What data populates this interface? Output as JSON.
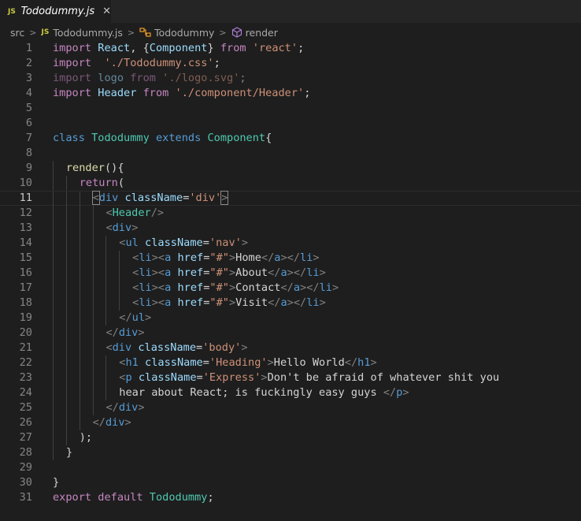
{
  "tab": {
    "badge": "JS",
    "title": "Tododummy.js",
    "close": "✕"
  },
  "breadcrumb": {
    "folder": "src",
    "file_badge": "JS",
    "file": "Tododummy.js",
    "class_name": "Tododummy",
    "method": "render",
    "separator": ">"
  },
  "editor": {
    "current_line": 11,
    "lines": [
      {
        "n": "1",
        "indent": 0,
        "t": [
          [
            "kw-imp",
            "import"
          ],
          [
            "plain",
            " "
          ],
          [
            "var",
            "React"
          ],
          [
            "plain",
            ", {"
          ],
          [
            "var",
            "Component"
          ],
          [
            "plain",
            "} "
          ],
          [
            "kw-imp",
            "from"
          ],
          [
            "plain",
            " "
          ],
          [
            "str",
            "'react'"
          ],
          [
            "plain",
            ";"
          ]
        ]
      },
      {
        "n": "2",
        "indent": 0,
        "t": [
          [
            "kw-imp",
            "import"
          ],
          [
            "plain",
            "  "
          ],
          [
            "str",
            "'./Tododummy.css'"
          ],
          [
            "plain",
            ";"
          ]
        ]
      },
      {
        "n": "3",
        "indent": 0,
        "dim": true,
        "t": [
          [
            "kw-imp",
            "import"
          ],
          [
            "plain",
            " "
          ],
          [
            "var",
            "logo"
          ],
          [
            "plain",
            " "
          ],
          [
            "kw-imp",
            "from"
          ],
          [
            "plain",
            " "
          ],
          [
            "str",
            "'./logo.svg'"
          ],
          [
            "plain",
            ";"
          ]
        ]
      },
      {
        "n": "4",
        "indent": 0,
        "t": [
          [
            "kw-imp",
            "import"
          ],
          [
            "plain",
            " "
          ],
          [
            "var",
            "Header"
          ],
          [
            "plain",
            " "
          ],
          [
            "kw-imp",
            "from"
          ],
          [
            "plain",
            " "
          ],
          [
            "str",
            "'./component/Header'"
          ],
          [
            "plain",
            ";"
          ]
        ]
      },
      {
        "n": "5",
        "indent": 0,
        "t": []
      },
      {
        "n": "6",
        "indent": 0,
        "t": []
      },
      {
        "n": "7",
        "indent": 0,
        "t": [
          [
            "kw",
            "class"
          ],
          [
            "plain",
            " "
          ],
          [
            "cls",
            "Tododummy"
          ],
          [
            "plain",
            " "
          ],
          [
            "kw",
            "extends"
          ],
          [
            "plain",
            " "
          ],
          [
            "cls",
            "Component"
          ],
          [
            "plain",
            "{"
          ]
        ]
      },
      {
        "n": "8",
        "indent": 0,
        "t": []
      },
      {
        "n": "9",
        "indent": 1,
        "t": [
          [
            "fn",
            "render"
          ],
          [
            "plain",
            "(){"
          ]
        ]
      },
      {
        "n": "10",
        "indent": 2,
        "t": [
          [
            "kw-imp",
            "return"
          ],
          [
            "plain",
            "("
          ]
        ]
      },
      {
        "n": "11",
        "indent": 3,
        "t": [
          [
            "brkt",
            "<"
          ],
          [
            "tag",
            "div"
          ],
          [
            "plain",
            " "
          ],
          [
            "attr",
            "className"
          ],
          [
            "plain",
            "="
          ],
          [
            "str",
            "'div'"
          ],
          [
            "brkt",
            ">"
          ]
        ]
      },
      {
        "n": "12",
        "indent": 4,
        "t": [
          [
            "brkt",
            "<"
          ],
          [
            "cls",
            "Header"
          ],
          [
            "brkt",
            "/>"
          ]
        ]
      },
      {
        "n": "13",
        "indent": 4,
        "t": [
          [
            "brkt",
            "<"
          ],
          [
            "tag",
            "div"
          ],
          [
            "brkt",
            ">"
          ]
        ]
      },
      {
        "n": "14",
        "indent": 5,
        "t": [
          [
            "brkt",
            "<"
          ],
          [
            "tag",
            "ul"
          ],
          [
            "plain",
            " "
          ],
          [
            "attr",
            "className"
          ],
          [
            "plain",
            "="
          ],
          [
            "str",
            "'nav'"
          ],
          [
            "brkt",
            ">"
          ]
        ]
      },
      {
        "n": "15",
        "indent": 6,
        "t": [
          [
            "brkt",
            "<"
          ],
          [
            "tag",
            "li"
          ],
          [
            "brkt",
            "><"
          ],
          [
            "tag",
            "a"
          ],
          [
            "plain",
            " "
          ],
          [
            "attr",
            "href"
          ],
          [
            "plain",
            "="
          ],
          [
            "str",
            "\"#\""
          ],
          [
            "brkt",
            ">"
          ],
          [
            "plain",
            "Home"
          ],
          [
            "brkt",
            "</"
          ],
          [
            "tag",
            "a"
          ],
          [
            "brkt",
            "></"
          ],
          [
            "tag",
            "li"
          ],
          [
            "brkt",
            ">"
          ]
        ]
      },
      {
        "n": "16",
        "indent": 6,
        "t": [
          [
            "brkt",
            "<"
          ],
          [
            "tag",
            "li"
          ],
          [
            "brkt",
            "><"
          ],
          [
            "tag",
            "a"
          ],
          [
            "plain",
            " "
          ],
          [
            "attr",
            "href"
          ],
          [
            "plain",
            "="
          ],
          [
            "str",
            "\"#\""
          ],
          [
            "brkt",
            ">"
          ],
          [
            "plain",
            "About"
          ],
          [
            "brkt",
            "</"
          ],
          [
            "tag",
            "a"
          ],
          [
            "brkt",
            "></"
          ],
          [
            "tag",
            "li"
          ],
          [
            "brkt",
            ">"
          ]
        ]
      },
      {
        "n": "17",
        "indent": 6,
        "t": [
          [
            "brkt",
            "<"
          ],
          [
            "tag",
            "li"
          ],
          [
            "brkt",
            "><"
          ],
          [
            "tag",
            "a"
          ],
          [
            "plain",
            " "
          ],
          [
            "attr",
            "href"
          ],
          [
            "plain",
            "="
          ],
          [
            "str",
            "\"#\""
          ],
          [
            "brkt",
            ">"
          ],
          [
            "plain",
            "Contact"
          ],
          [
            "brkt",
            "</"
          ],
          [
            "tag",
            "a"
          ],
          [
            "brkt",
            "></"
          ],
          [
            "tag",
            "li"
          ],
          [
            "brkt",
            ">"
          ]
        ]
      },
      {
        "n": "18",
        "indent": 6,
        "t": [
          [
            "brkt",
            "<"
          ],
          [
            "tag",
            "li"
          ],
          [
            "brkt",
            "><"
          ],
          [
            "tag",
            "a"
          ],
          [
            "plain",
            " "
          ],
          [
            "attr",
            "href"
          ],
          [
            "plain",
            "="
          ],
          [
            "str",
            "\"#\""
          ],
          [
            "brkt",
            ">"
          ],
          [
            "plain",
            "Visit"
          ],
          [
            "brkt",
            "</"
          ],
          [
            "tag",
            "a"
          ],
          [
            "brkt",
            "></"
          ],
          [
            "tag",
            "li"
          ],
          [
            "brkt",
            ">"
          ]
        ]
      },
      {
        "n": "19",
        "indent": 5,
        "t": [
          [
            "brkt",
            "</"
          ],
          [
            "tag",
            "ul"
          ],
          [
            "brkt",
            ">"
          ]
        ]
      },
      {
        "n": "20",
        "indent": 4,
        "t": [
          [
            "brkt",
            "</"
          ],
          [
            "tag",
            "div"
          ],
          [
            "brkt",
            ">"
          ]
        ]
      },
      {
        "n": "21",
        "indent": 4,
        "t": [
          [
            "brkt",
            "<"
          ],
          [
            "tag",
            "div"
          ],
          [
            "plain",
            " "
          ],
          [
            "attr",
            "className"
          ],
          [
            "plain",
            "="
          ],
          [
            "str",
            "'body'"
          ],
          [
            "brkt",
            ">"
          ]
        ]
      },
      {
        "n": "22",
        "indent": 5,
        "t": [
          [
            "brkt",
            "<"
          ],
          [
            "tag",
            "h1"
          ],
          [
            "plain",
            " "
          ],
          [
            "attr",
            "className"
          ],
          [
            "plain",
            "="
          ],
          [
            "str",
            "'Heading'"
          ],
          [
            "brkt",
            ">"
          ],
          [
            "plain",
            "Hello World"
          ],
          [
            "brkt",
            "</"
          ],
          [
            "tag",
            "h1"
          ],
          [
            "brkt",
            ">"
          ]
        ]
      },
      {
        "n": "23",
        "indent": 5,
        "t": [
          [
            "brkt",
            "<"
          ],
          [
            "tag",
            "p"
          ],
          [
            "plain",
            " "
          ],
          [
            "attr",
            "className"
          ],
          [
            "plain",
            "="
          ],
          [
            "str",
            "'Express'"
          ],
          [
            "brkt",
            ">"
          ],
          [
            "plain",
            "Don't be afraid of whatever shit you"
          ]
        ]
      },
      {
        "n": "24",
        "indent": 5,
        "t": [
          [
            "plain",
            "hear about React; is fuckingly easy guys "
          ],
          [
            "brkt",
            "</"
          ],
          [
            "tag",
            "p"
          ],
          [
            "brkt",
            ">"
          ]
        ]
      },
      {
        "n": "25",
        "indent": 4,
        "t": [
          [
            "brkt",
            "</"
          ],
          [
            "tag",
            "div"
          ],
          [
            "brkt",
            ">"
          ]
        ]
      },
      {
        "n": "26",
        "indent": 3,
        "t": [
          [
            "brkt",
            "</"
          ],
          [
            "tag",
            "div"
          ],
          [
            "brkt",
            ">"
          ]
        ]
      },
      {
        "n": "27",
        "indent": 2,
        "t": [
          [
            "plain",
            ");"
          ]
        ]
      },
      {
        "n": "28",
        "indent": 1,
        "t": [
          [
            "plain",
            "}"
          ]
        ]
      },
      {
        "n": "29",
        "indent": 0,
        "t": []
      },
      {
        "n": "30",
        "indent": 0,
        "t": [
          [
            "plain",
            "}"
          ]
        ]
      },
      {
        "n": "31",
        "indent": 0,
        "t": [
          [
            "kw-imp",
            "export"
          ],
          [
            "plain",
            " "
          ],
          [
            "kw-imp",
            "default"
          ],
          [
            "plain",
            " "
          ],
          [
            "cls",
            "Tododummy"
          ],
          [
            "plain",
            ";"
          ]
        ]
      }
    ]
  }
}
